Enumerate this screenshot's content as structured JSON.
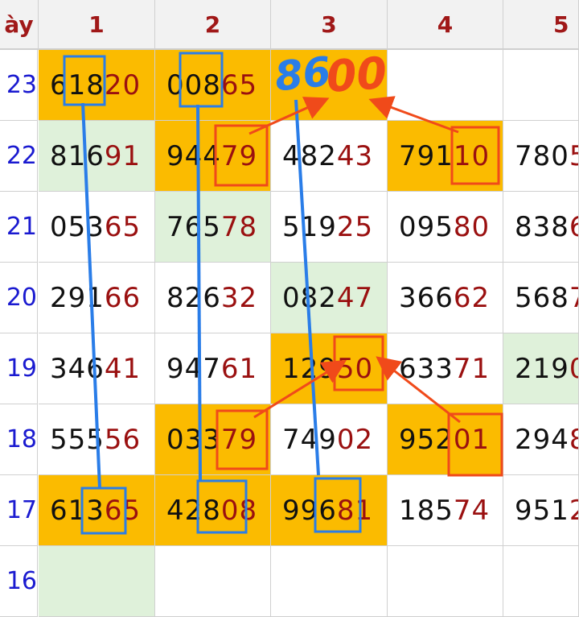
{
  "header": {
    "day_label": "ày",
    "columns": [
      "1",
      "2",
      "3",
      "4",
      "5"
    ]
  },
  "rows": [
    {
      "day": "23",
      "cells": [
        {
          "head": "618",
          "tail": "20",
          "bg": "gold"
        },
        {
          "head": "008",
          "tail": "65",
          "bg": "gold"
        },
        {
          "head": "",
          "tail": "",
          "bg": "gold"
        },
        {
          "head": "",
          "tail": "",
          "bg": "white"
        },
        {
          "head": "",
          "tail": "",
          "bg": "white"
        }
      ]
    },
    {
      "day": "22",
      "cells": [
        {
          "head": "816",
          "tail": "91",
          "bg": "green"
        },
        {
          "head": "944",
          "tail": "79",
          "bg": "gold"
        },
        {
          "head": "482",
          "tail": "43",
          "bg": "white"
        },
        {
          "head": "791",
          "tail": "10",
          "bg": "gold"
        },
        {
          "head": "780",
          "tail": "5",
          "bg": "white"
        }
      ]
    },
    {
      "day": "21",
      "cells": [
        {
          "head": "053",
          "tail": "65",
          "bg": "white"
        },
        {
          "head": "765",
          "tail": "78",
          "bg": "green"
        },
        {
          "head": "519",
          "tail": "25",
          "bg": "white"
        },
        {
          "head": "095",
          "tail": "80",
          "bg": "white"
        },
        {
          "head": "838",
          "tail": "6",
          "bg": "white"
        }
      ]
    },
    {
      "day": "20",
      "cells": [
        {
          "head": "291",
          "tail": "66",
          "bg": "white"
        },
        {
          "head": "826",
          "tail": "32",
          "bg": "white"
        },
        {
          "head": "082",
          "tail": "47",
          "bg": "green"
        },
        {
          "head": "366",
          "tail": "62",
          "bg": "white"
        },
        {
          "head": "568",
          "tail": "7",
          "bg": "white"
        }
      ]
    },
    {
      "day": "19",
      "cells": [
        {
          "head": "346",
          "tail": "41",
          "bg": "white"
        },
        {
          "head": "947",
          "tail": "61",
          "bg": "white"
        },
        {
          "head": "129",
          "tail": "50",
          "bg": "gold"
        },
        {
          "head": "633",
          "tail": "71",
          "bg": "white"
        },
        {
          "head": "219",
          "tail": "0",
          "bg": "green"
        }
      ]
    },
    {
      "day": "18",
      "cells": [
        {
          "head": "555",
          "tail": "56",
          "bg": "white"
        },
        {
          "head": "033",
          "tail": "79",
          "bg": "gold"
        },
        {
          "head": "749",
          "tail": "02",
          "bg": "white"
        },
        {
          "head": "952",
          "tail": "01",
          "bg": "gold"
        },
        {
          "head": "294",
          "tail": "8",
          "bg": "white"
        }
      ]
    },
    {
      "day": "17",
      "cells": [
        {
          "head": "613",
          "tail": "65",
          "bg": "gold"
        },
        {
          "head": "428",
          "tail": "08",
          "bg": "gold"
        },
        {
          "head": "996",
          "tail": "81",
          "bg": "gold"
        },
        {
          "head": "185",
          "tail": "74",
          "bg": "white"
        },
        {
          "head": "951",
          "tail": "2",
          "bg": "white"
        }
      ]
    },
    {
      "day": "16",
      "cells": [
        {
          "head": "",
          "tail": "",
          "bg": "green"
        },
        {
          "head": "",
          "tail": "",
          "bg": "white"
        },
        {
          "head": "",
          "tail": "",
          "bg": "white"
        },
        {
          "head": "",
          "tail": "",
          "bg": "white"
        },
        {
          "head": "",
          "tail": "",
          "bg": "white"
        }
      ]
    }
  ],
  "annotations": {
    "blue_note": "86",
    "red_note": "00",
    "colors": {
      "blue": "#2a7de8",
      "red": "#f04a1a",
      "gold": "#fbbb00",
      "green": "#dff1da"
    }
  }
}
